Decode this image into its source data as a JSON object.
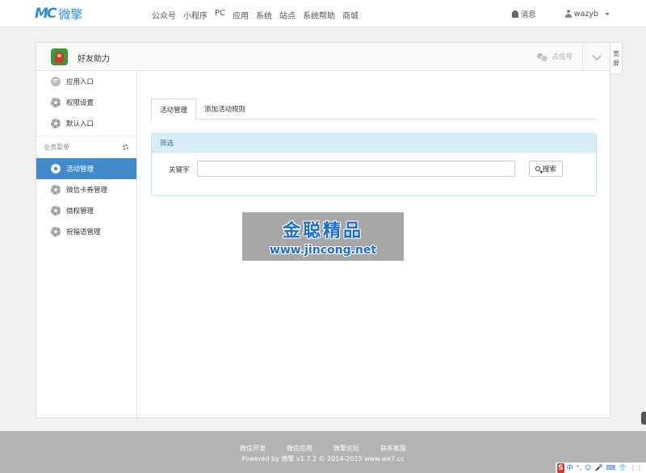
{
  "brand": {
    "mark": "MC",
    "name": "微擎"
  },
  "topnav": [
    "公众号",
    "小程序",
    "PC",
    "应用",
    "系统",
    "站点",
    "系统帮助",
    "商城"
  ],
  "header_right": {
    "messages": "消息",
    "username": "wazyb"
  },
  "app": {
    "name": "好友助力",
    "account": "占位号"
  },
  "side_tab": "宽屏",
  "sidebar": {
    "top_items": [
      "应用入口",
      "权限设置",
      "默认入口"
    ],
    "group_label": "业务菜单",
    "group_items": [
      "活动管理",
      "微信卡券管理",
      "借权管理",
      "祝福语管理"
    ],
    "active": "活动管理"
  },
  "tabs": [
    "活动管理",
    "添加活动规则"
  ],
  "filter": {
    "title": "筛选",
    "keyword_label": "关键字",
    "keyword_value": "",
    "search_button": "搜索"
  },
  "watermark": {
    "cn": "金聪精品",
    "url": "www.jincong.net"
  },
  "footer": {
    "links": [
      "微信开发",
      "微信应用",
      "微擎论坛",
      "联系客服"
    ],
    "copyright": "Powered by 微擎 v1.7.2 © 2014-2015 www.we7.cc"
  },
  "ime": {
    "logo": "S",
    "items": [
      "中",
      "°,",
      "☺",
      "🎤",
      "⌨",
      "👕",
      "⋮⋮"
    ]
  },
  "colors": {
    "brand": "#2b8fd6",
    "active": "#428bca",
    "filter_head": "#d9edf7"
  }
}
